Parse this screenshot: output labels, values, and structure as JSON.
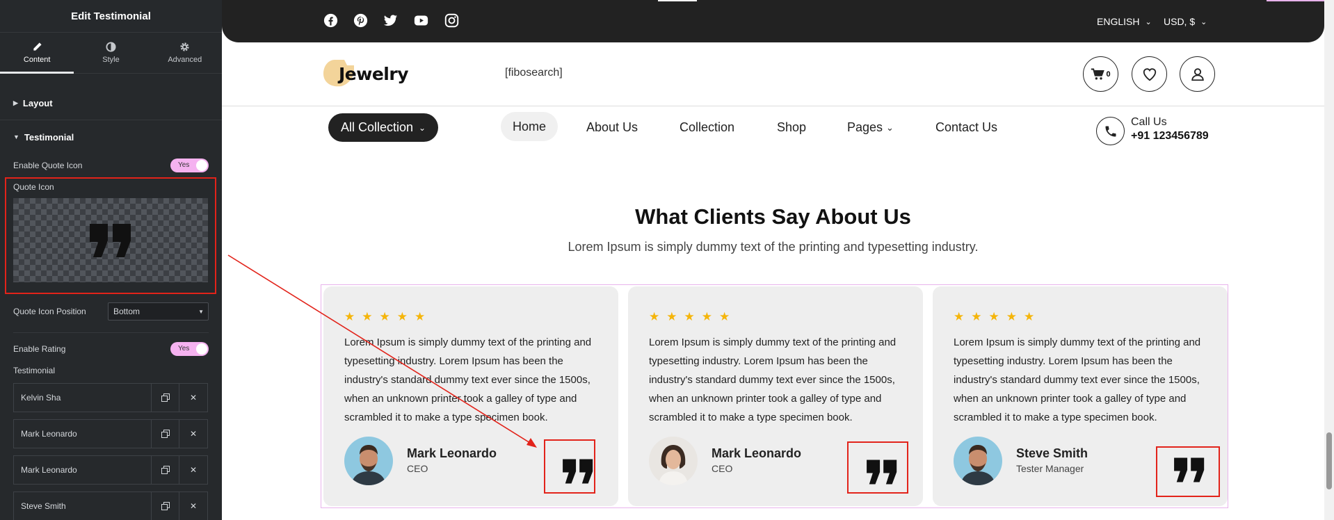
{
  "editor": {
    "title": "Edit Testimonial",
    "tabs": [
      {
        "label": "Content"
      },
      {
        "label": "Style"
      },
      {
        "label": "Advanced"
      }
    ],
    "sections": {
      "layout": "Layout",
      "testimonial": "Testimonial"
    },
    "enable_quote_icon": {
      "label": "Enable Quote Icon",
      "value": "Yes"
    },
    "quote_icon": {
      "label": "Quote Icon"
    },
    "quote_icon_position": {
      "label": "Quote Icon Position",
      "value": "Bottom"
    },
    "enable_rating": {
      "label": "Enable Rating",
      "value": "Yes"
    },
    "testimonial_label": "Testimonial",
    "items": [
      {
        "label": "Kelvin Sha"
      },
      {
        "label": "Mark Leonardo"
      },
      {
        "label": "Mark Leonardo"
      },
      {
        "label": "Steve Smith"
      }
    ]
  },
  "site": {
    "topbar": {
      "language": "ENGLISH",
      "currency": "USD, $"
    },
    "logo": "Jewelry",
    "search_placeholder": "[fibosearch]",
    "cart_count": "0",
    "nav": {
      "all_collection": "All Collection",
      "items": [
        "Home",
        "About Us",
        "Collection",
        "Shop",
        "Pages",
        "Contact Us"
      ],
      "call_label": "Call Us",
      "call_number": "+91 123456789"
    },
    "section_title": "What Clients Say About Us",
    "section_subtitle": "Lorem Ipsum is simply dummy text of the printing and typesetting industry.",
    "testimonials": [
      {
        "text": "Lorem Ipsum is simply dummy text of the printing and typesetting industry. Lorem Ipsum has been the industry's standard dummy text ever since the 1500s, when an unknown printer took a galley of type and scrambled it to make a type specimen book.",
        "name": "Mark Leonardo",
        "role": "CEO",
        "rating": 5
      },
      {
        "text": "Lorem Ipsum is simply dummy text of the printing and typesetting industry. Lorem Ipsum has been the industry's standard dummy text ever since the 1500s, when an unknown printer took a galley of type and scrambled it to make a type specimen book.",
        "name": "Mark Leonardo",
        "role": "CEO",
        "rating": 5
      },
      {
        "text": "Lorem Ipsum is simply dummy text of the printing and typesetting industry. Lorem Ipsum has been the industry's standard dummy text ever since the 1500s, when an unknown printer took a galley of type and scrambled it to make a type specimen book.",
        "name": "Steve Smith",
        "role": "Tester Manager",
        "rating": 5
      }
    ]
  },
  "colors": {
    "accent_pink": "#f5b2f0",
    "annotation_red": "#e2231a",
    "star": "#f5b50a",
    "panel_bg": "#26292c",
    "topbar_bg": "#222222"
  }
}
